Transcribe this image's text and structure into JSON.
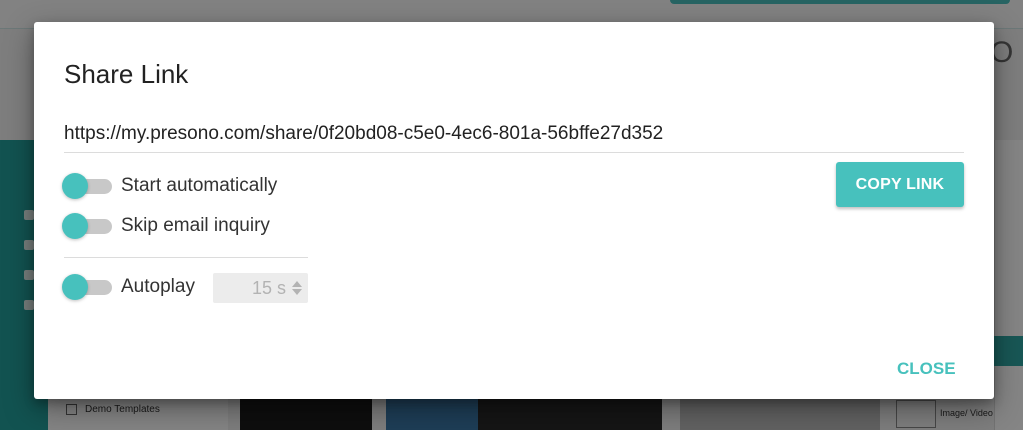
{
  "dialog": {
    "title": "Share Link",
    "url": "https://my.presono.com/share/0f20bd08-c5e0-4ec6-801a-56bffe27d352",
    "copy_label": "COPY LINK",
    "close_label": "CLOSE",
    "accent_color": "#47c1bd",
    "toggles": {
      "start_automatically": {
        "label": "Start automatically",
        "on": false
      },
      "skip_email_inquiry": {
        "label": "Skip email inquiry",
        "on": false
      },
      "autoplay": {
        "label": "Autoplay",
        "on": false
      }
    },
    "autoplay_seconds": "15 s"
  },
  "background": {
    "demo_templates_label": "Demo Templates",
    "image_video_label": "Image/ Video"
  }
}
